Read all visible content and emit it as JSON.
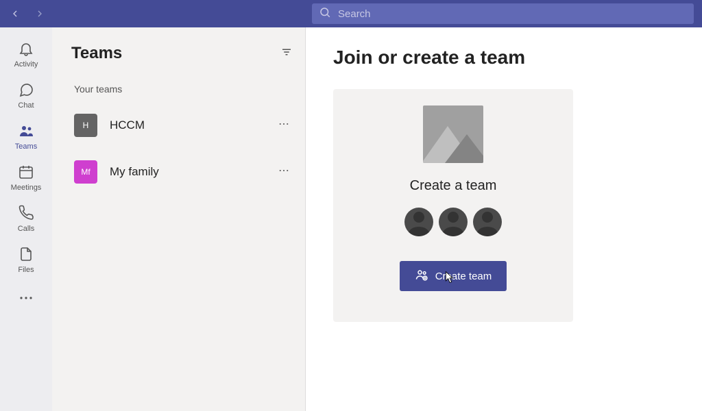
{
  "search": {
    "placeholder": "Search"
  },
  "rail": {
    "activity": "Activity",
    "chat": "Chat",
    "teams": "Teams",
    "meetings": "Meetings",
    "calls": "Calls",
    "files": "Files",
    "active": "teams"
  },
  "teamslist": {
    "title": "Teams",
    "section_label": "Your teams",
    "items": [
      {
        "initial": "H",
        "name": "HCCM",
        "color": "#646464"
      },
      {
        "initial": "Mf",
        "name": "My family",
        "color": "#cf3fcf"
      }
    ]
  },
  "content": {
    "heading": "Join or create a team",
    "card": {
      "title": "Create a team",
      "button_label": "Create team"
    }
  }
}
